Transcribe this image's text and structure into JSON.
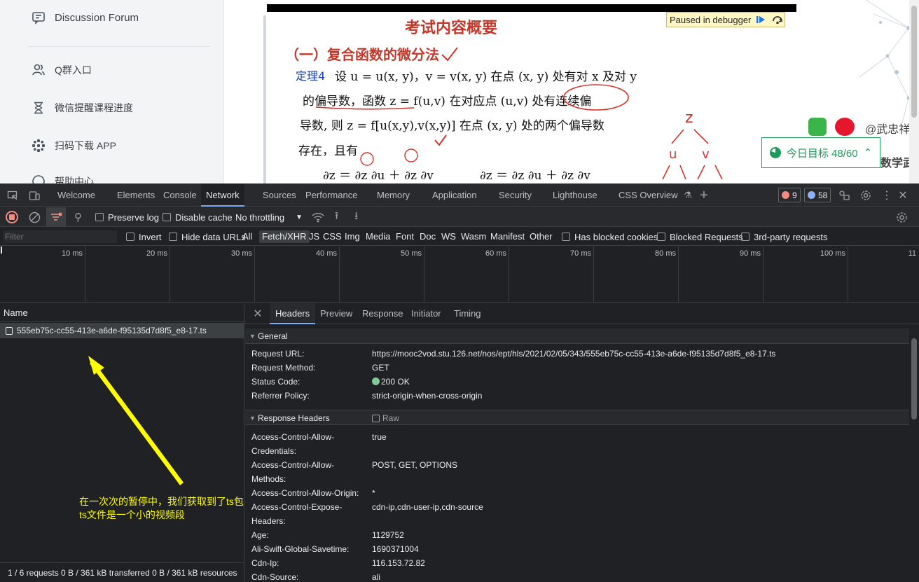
{
  "sidebar": {
    "items": [
      {
        "label": "Discussion Forum",
        "icon": "discussion-icon"
      },
      {
        "label": "Q群入口",
        "icon": "group-icon"
      },
      {
        "label": "微信提醒课程进度",
        "icon": "hourglass-icon"
      },
      {
        "label": "扫码下载 APP",
        "icon": "app-icon"
      },
      {
        "label": "帮助中心",
        "icon": "help-icon"
      }
    ]
  },
  "slide": {
    "debugger_label": "Paused in debugger",
    "heading": "考试内容概要",
    "section_title": "（一）复合函数的微分法",
    "theorem_label": "定理4",
    "line1": "设 u = u(x, y)，v = v(x, y) 在点 (x, y) 处有对 x 及对 y",
    "line2": "的偏导数，函数 z = f(u,v) 在对应点 (u,v) 处有连续偏",
    "line3": "导数, 则 z = f[u(x,y),v(x,y)] 在点 (x, y) 处的两个偏导数",
    "line4": "存在，且有",
    "formula_left": "∂z ＝ ∂z ∂u ＋ ∂z ∂v",
    "formula_right": "∂z ＝ ∂z ∂u ＋ ∂z ∂v",
    "watermark": "@武忠祥",
    "watermark2": "数学武"
  },
  "goal": {
    "label": "今日目标 48/60"
  },
  "devtools": {
    "tabs": [
      "Welcome",
      "Elements",
      "Console",
      "Network",
      "Sources",
      "Performance",
      "Memory",
      "Application",
      "Security",
      "Lighthouse",
      "CSS Overview"
    ],
    "active_tab": "Network",
    "errors": "9",
    "messages": "58",
    "toolbar": {
      "preserve_log": "Preserve log",
      "disable_cache": "Disable cache",
      "throttling": "No throttling"
    },
    "filter": {
      "placeholder": "Filter",
      "invert": "Invert",
      "hide_data_urls": "Hide data URLs",
      "types": [
        "All",
        "Fetch/XHR",
        "JS",
        "CSS",
        "Img",
        "Media",
        "Font",
        "Doc",
        "WS",
        "Wasm",
        "Manifest",
        "Other"
      ],
      "active_type": "Fetch/XHR",
      "blocked_cookies": "Has blocked cookies",
      "blocked_requests": "Blocked Requests",
      "third_party": "3rd-party requests"
    },
    "timeline": [
      "10 ms",
      "20 ms",
      "30 ms",
      "40 ms",
      "50 ms",
      "60 ms",
      "70 ms",
      "80 ms",
      "90 ms",
      "100 ms",
      "11"
    ],
    "requests": {
      "column": "Name",
      "rows": [
        "555eb75c-cc55-413e-a6de-f95135d7d8f5_e8-17.ts"
      ],
      "status": "1 / 6 requests  0 B / 361 kB transferred  0 B / 361 kB resources"
    },
    "annotation": {
      "line1": "在一次次的暂停中，我们获取到了ts包",
      "line2": "ts文件是一个小的视频段"
    },
    "details": {
      "tabs": [
        "Headers",
        "Preview",
        "Response",
        "Initiator",
        "Timing"
      ],
      "active_tab": "Headers",
      "general_title": "General",
      "general": [
        {
          "k": "Request URL:",
          "v": "https://mooc2vod.stu.126.net/nos/ept/hls/2021/02/05/343/555eb75c-cc55-413e-a6de-f95135d7d8f5_e8-17.ts"
        },
        {
          "k": "Request Method:",
          "v": "GET"
        },
        {
          "k": "Status Code:",
          "v": "200 OK"
        },
        {
          "k": "Referrer Policy:",
          "v": "strict-origin-when-cross-origin"
        }
      ],
      "response_title": "Response Headers",
      "raw_label": "Raw",
      "response": [
        {
          "k1": "Access-Control-Allow-",
          "k2": "Credentials:",
          "v": "true"
        },
        {
          "k1": "Access-Control-Allow-",
          "k2": "Methods:",
          "v": "POST, GET, OPTIONS"
        },
        {
          "k1": "Access-Control-Allow-Origin:",
          "k2": "",
          "v": "*"
        },
        {
          "k1": "Access-Control-Expose-",
          "k2": "Headers:",
          "v": "cdn-ip,cdn-user-ip,cdn-source"
        },
        {
          "k1": "Age:",
          "k2": "",
          "v": "1129752"
        },
        {
          "k1": "Ali-Swift-Global-Savetime:",
          "k2": "",
          "v": "1690371004"
        },
        {
          "k1": "Cdn-Ip:",
          "k2": "",
          "v": "116.153.72.82"
        },
        {
          "k1": "Cdn-Source:",
          "k2": "",
          "v": "ali"
        }
      ]
    }
  },
  "colors": {
    "accent": "#7cacf8",
    "annotation": "#ffff00",
    "goal": "#1e9b5a",
    "slide_red": "#c0392b"
  }
}
